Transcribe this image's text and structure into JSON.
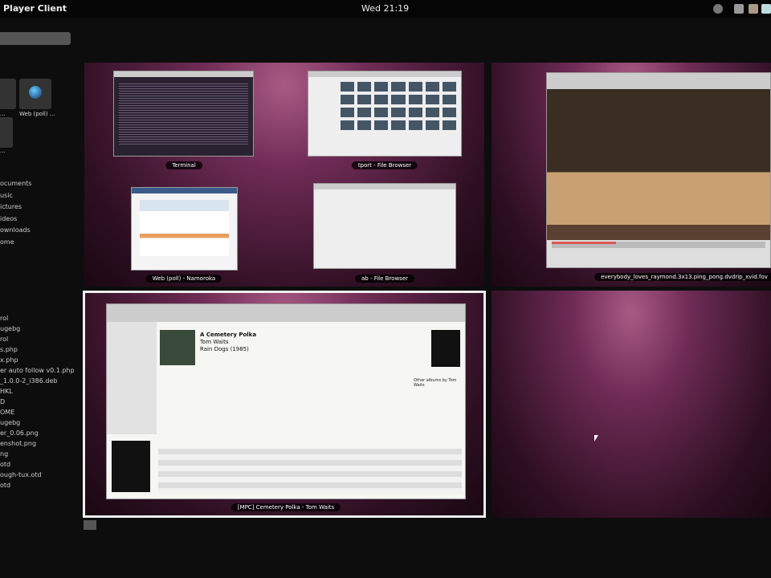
{
  "topbar": {
    "app_title": "Player Client",
    "clock": "Wed 21:19"
  },
  "sidebar": {
    "apps": [
      {
        "label": "..."
      },
      {
        "label": "Web (poll) ..."
      },
      {
        "label": "..."
      }
    ],
    "places": [
      "ocuments",
      "usic",
      "ictures",
      "ideos",
      "ownloads",
      "ome"
    ],
    "recent": [
      "rol",
      "ugebg",
      "rol",
      "s.php",
      "x.php",
      "er auto follow v0.1.php",
      "_1.0.0-2_i386.deb",
      "HKL",
      "D",
      "OME",
      "",
      "ugebg",
      "er_0.06.png",
      "enshot.png",
      "ng",
      "otd",
      "ough-tux.otd",
      "otd"
    ]
  },
  "workspaces": [
    {
      "windows": [
        {
          "label": "Terminal"
        },
        {
          "label": "tport - File Browser"
        },
        {
          "label": "Web (poll) - Namoroka"
        },
        {
          "label": "ab - File Browser"
        }
      ]
    },
    {
      "windows": [
        {
          "label": "everybody_loves_raymond.3x13.ping_pong.dvdrip_xvid.fov"
        }
      ]
    },
    {
      "windows": [
        {
          "label": "[MPC] Cemetery Polka - Tom Waits",
          "song": "A Cemetery Polka",
          "artist": "Tom Waits",
          "album": "Rain Dogs (1985)",
          "side": "Other albums by Tom Waits"
        }
      ]
    },
    {
      "windows": []
    }
  ]
}
